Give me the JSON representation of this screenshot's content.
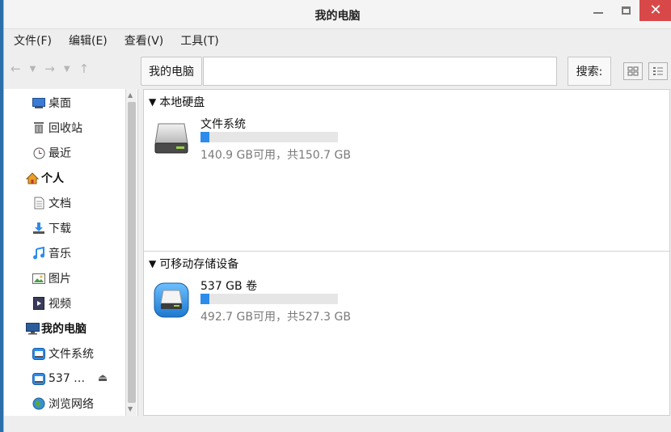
{
  "window": {
    "title": "我的电脑"
  },
  "menu": [
    "文件(F)",
    "编辑(E)",
    "查看(V)",
    "工具(T)"
  ],
  "toolbar": {
    "location_label": "我的电脑",
    "location_value": "",
    "search_label": "搜索:"
  },
  "sidebar": {
    "items": [
      {
        "label": "桌面",
        "icon": "desktop-icon"
      },
      {
        "label": "回收站",
        "icon": "trash-icon"
      },
      {
        "label": "最近",
        "icon": "clock-icon"
      }
    ],
    "personal_header": {
      "label": "个人",
      "icon": "home-icon"
    },
    "personal": [
      {
        "label": "文档",
        "icon": "document-icon"
      },
      {
        "label": "下载",
        "icon": "download-icon"
      },
      {
        "label": "音乐",
        "icon": "music-icon"
      },
      {
        "label": "图片",
        "icon": "picture-icon"
      },
      {
        "label": "视频",
        "icon": "video-icon"
      }
    ],
    "computer_header": {
      "label": "我的电脑",
      "icon": "computer-icon"
    },
    "computer": [
      {
        "label": "文件系统",
        "icon": "drive-icon"
      },
      {
        "label": "537 …",
        "icon": "drive-icon"
      },
      {
        "label": "浏览网络",
        "icon": "network-icon"
      }
    ]
  },
  "groups": [
    {
      "title": "本地硬盘",
      "drives": [
        {
          "name": "文件系统",
          "space": "140.9 GB可用，共150.7 GB",
          "used_fraction": 0.065
        }
      ]
    },
    {
      "title": "可移动存储设备",
      "drives": [
        {
          "name": "537 GB 卷",
          "space": "492.7 GB可用，共527.3 GB",
          "used_fraction": 0.066
        }
      ]
    }
  ],
  "colors": {
    "accent": "#2d8ceb",
    "close": "#d94848"
  }
}
